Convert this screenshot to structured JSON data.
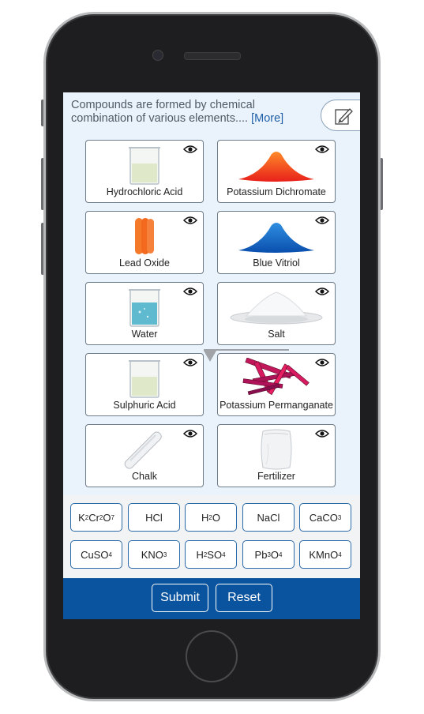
{
  "intro": {
    "text": "Compounds are formed by chemical combination of various elements....",
    "more_link": "[More]"
  },
  "compounds": [
    {
      "label": "Hydrochloric Acid",
      "icon": "beaker-icon"
    },
    {
      "label": "Potassium Dichromate",
      "icon": "orange-powder-icon"
    },
    {
      "label": "Lead Oxide",
      "icon": "lead-oxide-sticks-icon"
    },
    {
      "label": "Blue Vitriol",
      "icon": "blue-powder-icon"
    },
    {
      "label": "Water",
      "icon": "water-beaker-icon"
    },
    {
      "label": "Salt",
      "icon": "salt-plate-icon"
    },
    {
      "label": "Sulphuric Acid",
      "icon": "beaker-icon"
    },
    {
      "label": "Potassium Permanganate",
      "icon": "permanganate-crystals-icon"
    },
    {
      "label": "Chalk",
      "icon": "chalk-stick-icon"
    },
    {
      "label": "Fertilizer",
      "icon": "fertilizer-bag-icon"
    }
  ],
  "formulas": [
    {
      "parts": [
        "K",
        "2",
        "Cr",
        "2",
        "O",
        "7"
      ]
    },
    {
      "parts": [
        "HCl"
      ]
    },
    {
      "parts": [
        "H",
        "2",
        "O"
      ]
    },
    {
      "parts": [
        "NaCl"
      ]
    },
    {
      "parts": [
        "CaCO",
        "3"
      ]
    },
    {
      "parts": [
        "CuSO",
        "4"
      ]
    },
    {
      "parts": [
        "KNO",
        "3"
      ]
    },
    {
      "parts": [
        "H",
        "2",
        "SO",
        "4"
      ]
    },
    {
      "parts": [
        "Pb",
        "3",
        "O",
        "4"
      ]
    },
    {
      "parts": [
        "KMnO",
        "4"
      ]
    }
  ],
  "footer": {
    "submit_label": "Submit",
    "reset_label": "Reset"
  },
  "colors": {
    "footer_bg": "#0a539e",
    "screen_bg": "#eaf3fb",
    "accent_link": "#1f5fa8"
  }
}
